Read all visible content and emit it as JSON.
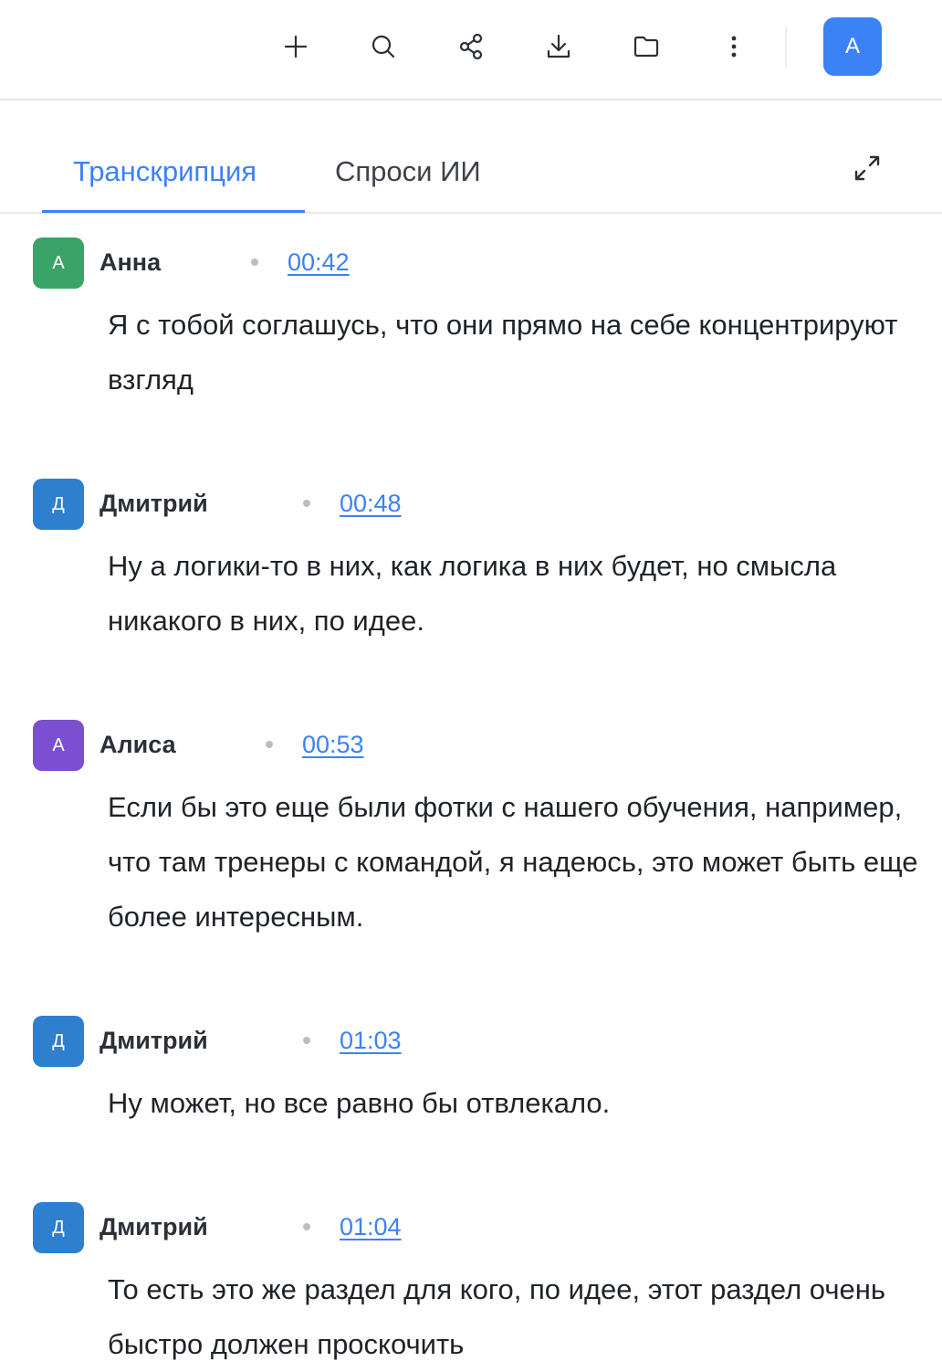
{
  "user": {
    "avatar_initial": "А",
    "color": "#3b82f6"
  },
  "toolbar": {
    "icons": [
      "plus-icon",
      "search-icon",
      "share-icon",
      "download-icon",
      "folder-icon",
      "more-vertical-icon"
    ]
  },
  "tabs": [
    {
      "label": "Транскрипция",
      "active": true
    },
    {
      "label": "Спроси ИИ",
      "active": false
    }
  ],
  "colors": {
    "accent": "#3b82f6",
    "green": "#3aa468",
    "blue": "#2e7fcd",
    "purple": "#7b4fd0"
  },
  "transcript": [
    {
      "initial": "А",
      "speaker": "Анна",
      "time": "00:42",
      "color": "#3aa468",
      "text": "Я с тобой соглашусь, что они прямо на себе концентрируют взгляд"
    },
    {
      "initial": "Д",
      "speaker": "Дмитрий",
      "time": "00:48",
      "color": "#2e7fcd",
      "text": "Ну а логики-то в них, как логика в них будет, но смысла никакого в них, по идее."
    },
    {
      "initial": "А",
      "speaker": "Алиса",
      "time": "00:53",
      "color": "#7b4fd0",
      "text": "Если бы это еще были фотки с нашего обучения, например, что там тренеры с командой, я надеюсь, это может быть еще более интересным."
    },
    {
      "initial": "Д",
      "speaker": "Дмитрий",
      "time": "01:03",
      "color": "#2e7fcd",
      "text": "Ну может, но все равно бы отвлекало."
    },
    {
      "initial": "Д",
      "speaker": "Дмитрий",
      "time": "01:04",
      "color": "#2e7fcd",
      "text": "То есть это же раздел для кого, по идее, этот раздел очень быстро должен проскочить"
    }
  ]
}
